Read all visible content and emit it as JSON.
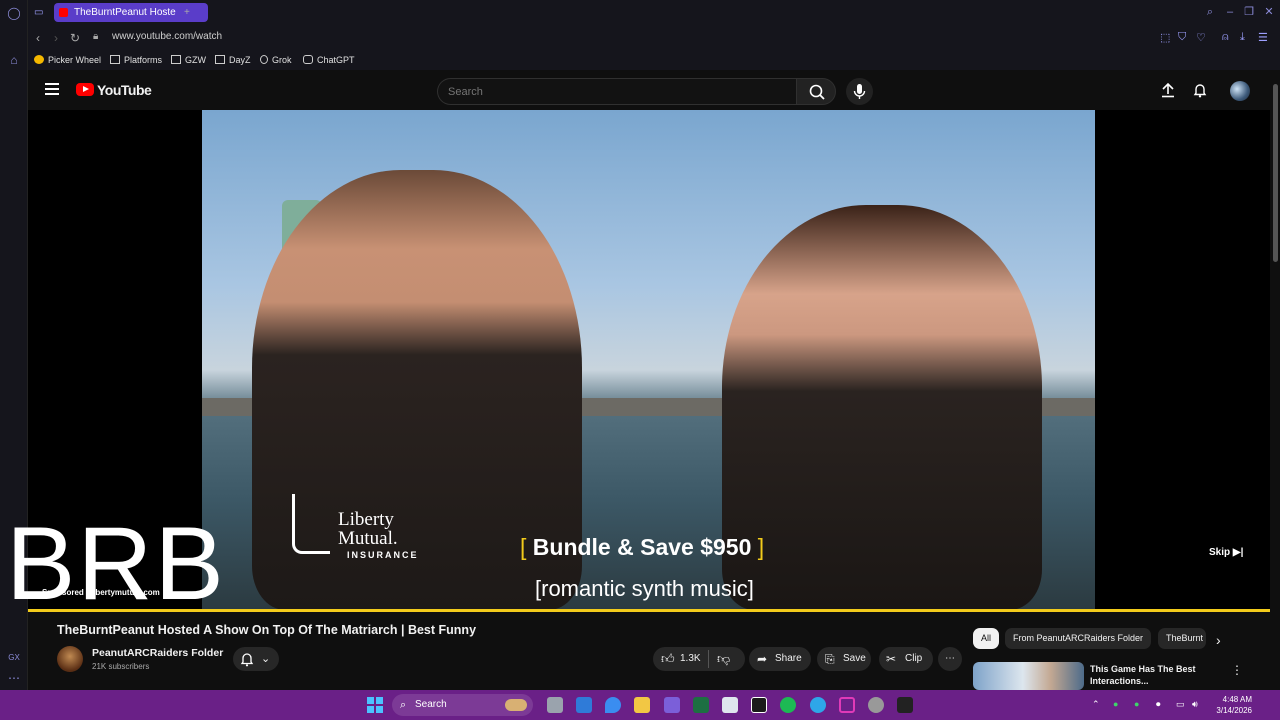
{
  "browser": {
    "tab_title": "TheBurntPeanut Hoste",
    "url": "www.youtube.com/watch",
    "bookmarks": [
      "Picker Wheel",
      "Platforms",
      "GZW",
      "DayZ",
      "Grok",
      "ChatGPT"
    ]
  },
  "masthead": {
    "logo_text": "YouTube",
    "search_placeholder": "Search"
  },
  "player": {
    "brand_name": "Liberty\nMutual.",
    "brand_sub": "INSURANCE",
    "promo_text": "Bundle & Save $950",
    "caption": "[romantic synth music]",
    "skip_label": "Skip",
    "overlay_text": "BRB",
    "sponsored": "Sponsored · libertymutual.com",
    "progress_color": "#f2cb1b"
  },
  "video": {
    "title": "TheBurntPeanut Hosted A Show On Top Of The Matriarch | Best Funny",
    "channel_name": "PeanutARCRaiders Folder",
    "subscribers": "21K subscribers",
    "likes": "1.3K",
    "share_label": "Share",
    "save_label": "Save",
    "clip_label": "Clip"
  },
  "sidebar": {
    "chips": [
      "All",
      "From PeanutARCRaiders Folder",
      "TheBurnt"
    ],
    "recommendation_title": "This Game Has The Best Interactions..."
  },
  "taskbar": {
    "search_label": "Search",
    "time": "4:48 AM",
    "date": "3/14/2026"
  },
  "colors": {
    "accent": "#5a3dc9",
    "youtube_red": "#ff0000",
    "taskbar": "#6a2087"
  }
}
